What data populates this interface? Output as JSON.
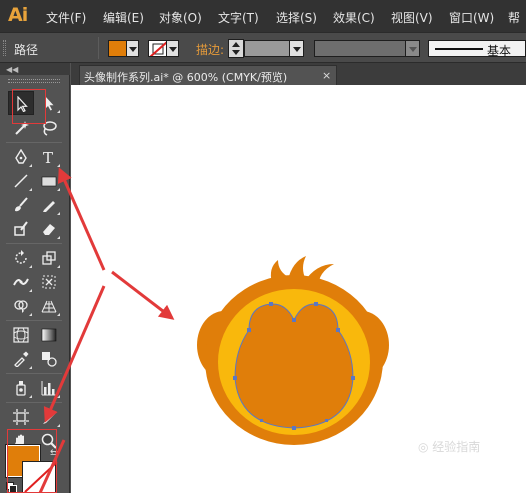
{
  "app": {
    "logo": "Ai"
  },
  "menu": {
    "items": [
      "文件(F)",
      "编辑(E)",
      "对象(O)",
      "文字(T)",
      "选择(S)",
      "效果(C)",
      "视图(V)",
      "窗口(W)",
      "帮"
    ]
  },
  "control_bar": {
    "selection_label": "路径",
    "fill_color": "#e07e0a",
    "stroke_label": "描边:",
    "stroke_value": "",
    "brush_value": "",
    "style_label": "基本"
  },
  "document": {
    "tab_title": "头像制作系列.ai* @ 600% (CMYK/预览)",
    "close_symbol": "×"
  },
  "toolbox": {
    "collapse_symbol": "◀◀",
    "text_tool_glyph": "T",
    "fill_color": "#e07e0a",
    "stroke_color": "none"
  },
  "artwork": {
    "outer_color": "#e07e0a",
    "ring_color": "#f9b80c",
    "face_color": "#e07e0a",
    "path_color": "#5b77c4"
  },
  "annotation_color": "#e23a3a",
  "watermark": "◎ 经验指南"
}
